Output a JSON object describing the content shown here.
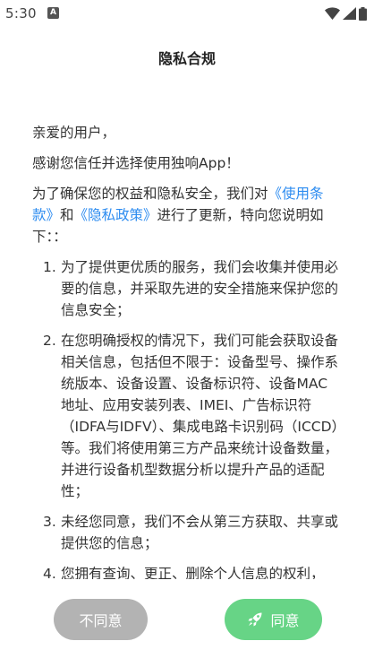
{
  "status_bar": {
    "time": "5:30",
    "notification_icon": "A"
  },
  "page": {
    "title": "隐私合规"
  },
  "content": {
    "greeting": "亲爱的用户，",
    "thanks": "感谢您信任并选择使用独响App！",
    "intro_prefix": "为了确保您的权益和隐私安全，我们对",
    "terms_link": "《使用条款》",
    "intro_and": "和",
    "privacy_link": "《隐私政策》",
    "intro_suffix": "进行了更新，特向您说明如下：：",
    "items": [
      {
        "num": "1.",
        "text": "为了提供更优质的服务，我们会收集并使用必要的信息，并采取先进的安全措施来保护您的信息安全；"
      },
      {
        "num": "2.",
        "text": "在您明确授权的情况下，我们可能会获取设备相关信息，包括但不限于：设备型号、操作系统版本、设备设置、设备标识符、设备MAC 地址、应用安装列表、IMEI、广告标识符（IDFA与IDFV）、集成电路卡识别码（ICCD）等。我们将使用第三方产品来统计设备数量，并进行设备机型数据分析以提升产品的适配性；"
      },
      {
        "num": "3.",
        "text": "未经您同意，我们不会从第三方获取、共享或提供您的信息；"
      },
      {
        "num": "4.",
        "text": "您拥有查询、更正、删除个人信息的权利，"
      }
    ]
  },
  "buttons": {
    "disagree": "不同意",
    "agree": "同意"
  },
  "colors": {
    "link": "#2d8cf0",
    "agree": "#67d486",
    "disagree": "#b3b3b3"
  }
}
